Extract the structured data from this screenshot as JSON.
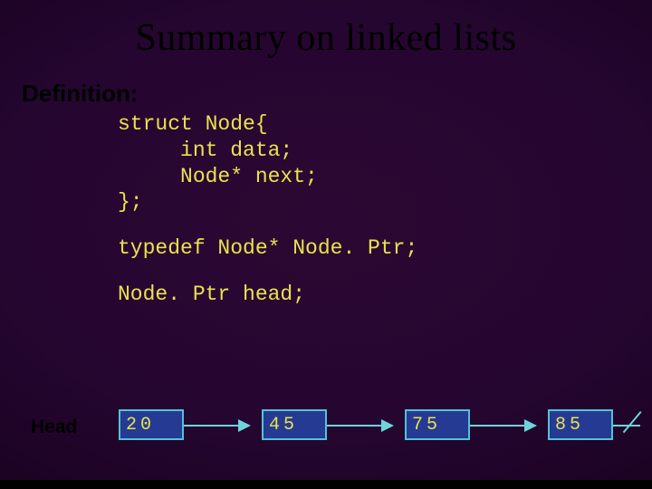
{
  "title": "Summary on linked lists",
  "section_label": "Definition:",
  "code": {
    "l1": "struct Node{",
    "l2": "     int data;",
    "l3": "     Node* next;",
    "l4": "};",
    "l5": "typedef Node* Node. Ptr;",
    "l6": "Node. Ptr head;"
  },
  "diagram": {
    "head_label": "Head",
    "nodes": [
      "20",
      "45",
      "75",
      "85"
    ]
  }
}
